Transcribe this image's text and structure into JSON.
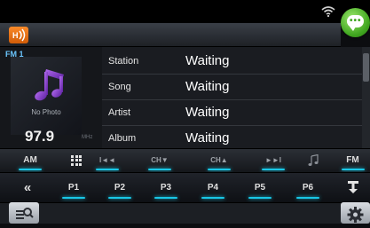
{
  "status": {},
  "source": {
    "icon": "hd-radio-icon",
    "band": "FM 1"
  },
  "left_panel": {
    "no_photo": "No Photo",
    "frequency": "97.9",
    "unit": "MHz"
  },
  "info": [
    {
      "label": "Station",
      "value": "Waiting"
    },
    {
      "label": "Song",
      "value": "Waiting"
    },
    {
      "label": "Artist",
      "value": "Waiting"
    },
    {
      "label": "Album",
      "value": "Waiting"
    }
  ],
  "controls": {
    "am": "AM",
    "prev": "I◄◄",
    "ch_down": "CH▼",
    "ch_up": "CH▲",
    "next": "►►I",
    "fm": "FM"
  },
  "presets": [
    "P1",
    "P2",
    "P3",
    "P4",
    "P5",
    "P6"
  ],
  "colors": {
    "accent": "#19c7e6",
    "band": "#6cc7ff",
    "chat": "#3fa51f",
    "hd_icon": "#f0761a"
  }
}
